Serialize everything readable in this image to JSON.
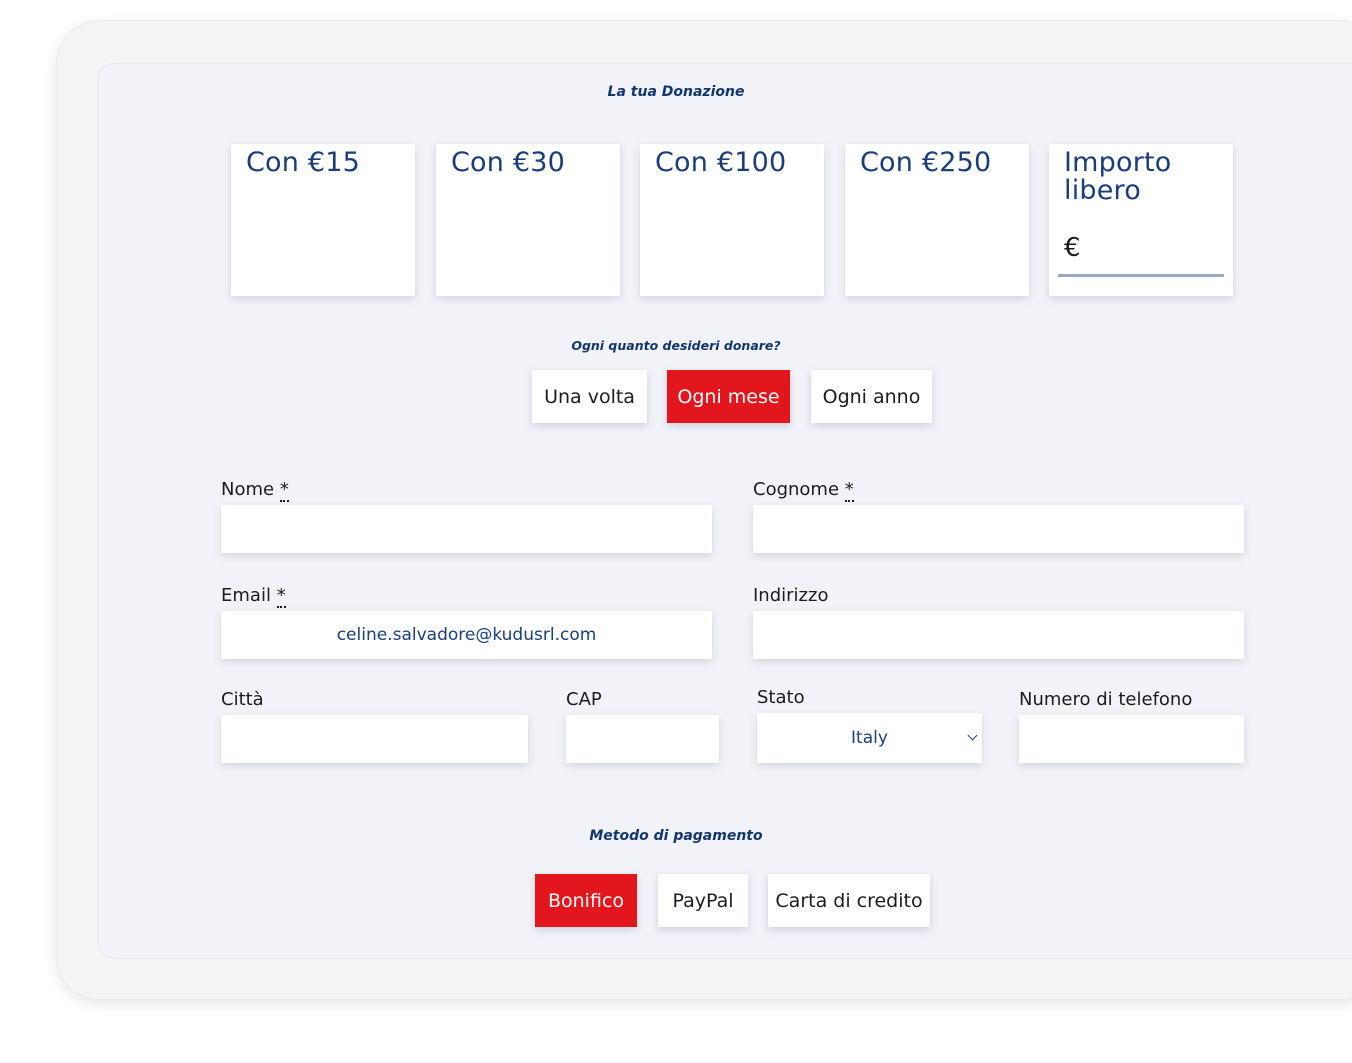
{
  "donation": {
    "title": "La tua Donazione",
    "amounts": [
      "Con €15",
      "Con €30",
      "Con €100",
      "Con €250"
    ],
    "free_amount": {
      "label": "Importo libero",
      "currency": "€",
      "value": ""
    }
  },
  "frequency": {
    "title": "Ogni quanto desideri donare?",
    "options": [
      "Una volta",
      "Ogni mese",
      "Ogni anno"
    ],
    "selected": "Ogni mese"
  },
  "form": {
    "nome": {
      "label": "Nome",
      "required_mark": "*",
      "value": ""
    },
    "cognome": {
      "label": "Cognome",
      "required_mark": "*",
      "value": ""
    },
    "email": {
      "label": "Email",
      "required_mark": "*",
      "value": "celine.salvadore@kudusrl.com"
    },
    "indirizzo": {
      "label": "Indirizzo",
      "value": ""
    },
    "citta": {
      "label": "Città",
      "value": ""
    },
    "cap": {
      "label": "CAP",
      "value": ""
    },
    "stato": {
      "label": "Stato",
      "value": "Italy"
    },
    "telefono": {
      "label": "Numero di telefono",
      "value": ""
    }
  },
  "payment": {
    "title": "Metodo di pagamento",
    "options": [
      "Bonifico",
      "PayPal",
      "Carta di credito"
    ],
    "selected": "Bonifico"
  },
  "colors": {
    "accent_red": "#e2161c",
    "brand_blue": "#1b3d7a",
    "panel_bg": "#f2f3f8"
  }
}
